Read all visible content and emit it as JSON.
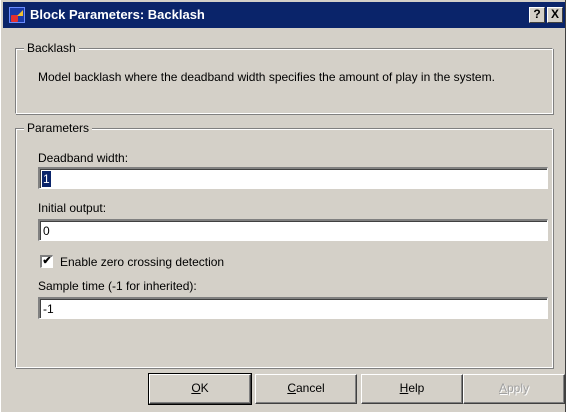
{
  "window": {
    "title": "Block Parameters: Backlash",
    "help_button": "?",
    "close_button": "X"
  },
  "backlash_group": {
    "legend": "Backlash",
    "description": "Model backlash where the deadband width specifies the amount of play in the system."
  },
  "parameters_group": {
    "legend": "Parameters",
    "deadband_width": {
      "label": "Deadband width:",
      "value": "1"
    },
    "initial_output": {
      "label": "Initial output:",
      "value": "0"
    },
    "zero_crossing": {
      "label": "Enable zero crossing detection",
      "checked": true,
      "mark": "✔"
    },
    "sample_time": {
      "label": "Sample time (-1 for inherited):",
      "value": "-1"
    }
  },
  "buttons": {
    "ok": {
      "mnemonic": "O",
      "rest": "K"
    },
    "cancel": {
      "mnemonic": "C",
      "rest": "ancel"
    },
    "help": {
      "mnemonic": "H",
      "rest": "elp"
    },
    "apply": {
      "mnemonic": "A",
      "rest": "pply"
    }
  }
}
